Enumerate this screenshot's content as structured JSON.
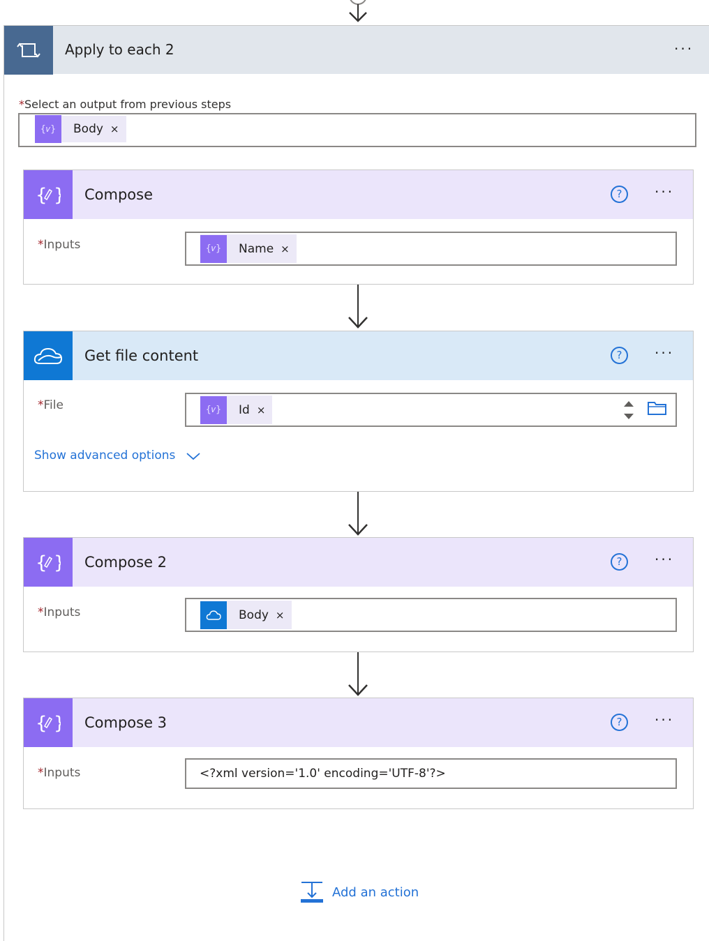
{
  "loop": {
    "title": "Apply to each 2",
    "menu": "···",
    "select_label": "Select an output from previous steps",
    "required_mark": "*",
    "token": {
      "label": "Body",
      "remove": "×",
      "icon": "expression-token-icon"
    }
  },
  "compose": {
    "title": "Compose",
    "help": "?",
    "menu": "···",
    "field_label": "Inputs",
    "token": {
      "label": "Name",
      "remove": "×",
      "icon": "expression-token-icon"
    }
  },
  "get_file": {
    "title": "Get file content",
    "help": "?",
    "menu": "···",
    "field_label": "File",
    "token": {
      "label": "Id",
      "remove": "×",
      "icon": "expression-token-icon"
    },
    "advanced": "Show advanced options"
  },
  "compose2": {
    "title": "Compose 2",
    "help": "?",
    "menu": "···",
    "field_label": "Inputs",
    "token": {
      "label": "Body",
      "remove": "×",
      "icon": "onedrive-token-icon"
    }
  },
  "compose3": {
    "title": "Compose 3",
    "help": "?",
    "menu": "···",
    "field_label": "Inputs",
    "value": "<?xml version='1.0' encoding='UTF-8'?>"
  },
  "add_action": "Add an action",
  "colors": {
    "loop_header": "#e1e6ec",
    "loop_icon": "#486991",
    "compose_accent": "#8c6cf2",
    "onedrive_accent": "#0f78d4",
    "link": "#2372d6"
  }
}
